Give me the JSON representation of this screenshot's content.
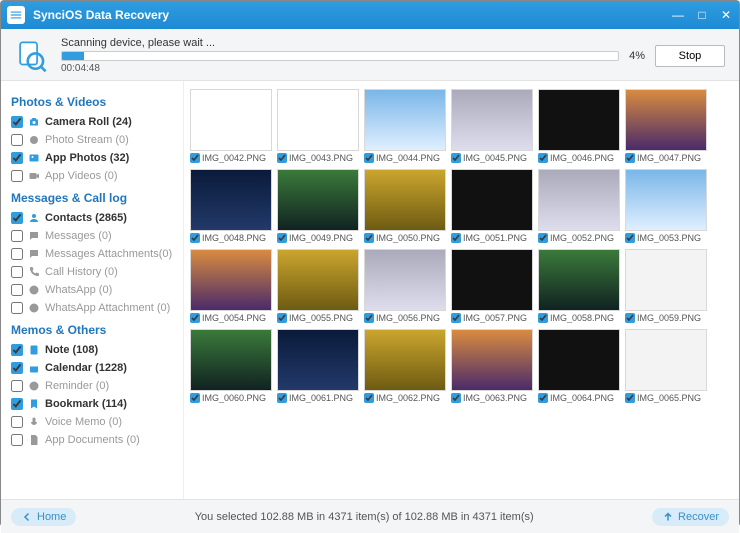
{
  "title": "SynciOS Data Recovery",
  "progress": {
    "label": "Scanning device, please wait ...",
    "elapsed": "00:04:48",
    "percent_text": "4%",
    "percent_value": 4,
    "stop_label": "Stop"
  },
  "sidebar": {
    "groups": [
      {
        "header": "Photos & Videos",
        "items": [
          {
            "checked": true,
            "active": true,
            "icon": "camera-icon",
            "label": "Camera Roll (24)"
          },
          {
            "checked": false,
            "active": false,
            "icon": "stream-icon",
            "label": "Photo Stream (0)"
          },
          {
            "checked": true,
            "active": true,
            "icon": "photo-icon",
            "label": "App Photos (32)"
          },
          {
            "checked": false,
            "active": false,
            "icon": "video-icon",
            "label": "App Videos (0)"
          }
        ]
      },
      {
        "header": "Messages & Call log",
        "items": [
          {
            "checked": true,
            "active": true,
            "icon": "contacts-icon",
            "label": "Contacts (2865)"
          },
          {
            "checked": false,
            "active": false,
            "icon": "message-icon",
            "label": "Messages (0)"
          },
          {
            "checked": false,
            "active": false,
            "icon": "attachment-icon",
            "label": "Messages Attachments(0)"
          },
          {
            "checked": false,
            "active": false,
            "icon": "phone-icon",
            "label": "Call History (0)"
          },
          {
            "checked": false,
            "active": false,
            "icon": "whatsapp-icon",
            "label": "WhatsApp (0)"
          },
          {
            "checked": false,
            "active": false,
            "icon": "whatsapp-attach-icon",
            "label": "WhatsApp Attachment (0)"
          }
        ]
      },
      {
        "header": "Memos & Others",
        "items": [
          {
            "checked": true,
            "active": true,
            "icon": "note-icon",
            "label": "Note (108)"
          },
          {
            "checked": true,
            "active": true,
            "icon": "calendar-icon",
            "label": "Calendar (1228)"
          },
          {
            "checked": false,
            "active": false,
            "icon": "reminder-icon",
            "label": "Reminder (0)"
          },
          {
            "checked": true,
            "active": true,
            "icon": "bookmark-icon",
            "label": "Bookmark (114)"
          },
          {
            "checked": false,
            "active": false,
            "icon": "voice-icon",
            "label": "Voice Memo (0)"
          },
          {
            "checked": false,
            "active": false,
            "icon": "document-icon",
            "label": "App Documents (0)"
          }
        ]
      }
    ]
  },
  "thumbnails": [
    {
      "name": "IMG_0042.PNG",
      "bg": "bg-white"
    },
    {
      "name": "IMG_0043.PNG",
      "bg": "bg-white"
    },
    {
      "name": "IMG_0044.PNG",
      "bg": "bg-blue"
    },
    {
      "name": "IMG_0045.PNG",
      "bg": "bg-grey"
    },
    {
      "name": "IMG_0046.PNG",
      "bg": "bg-dark"
    },
    {
      "name": "IMG_0047.PNG",
      "bg": "bg-sunset"
    },
    {
      "name": "IMG_0048.PNG",
      "bg": "bg-night"
    },
    {
      "name": "IMG_0049.PNG",
      "bg": "bg-green"
    },
    {
      "name": "IMG_0050.PNG",
      "bg": "bg-yel"
    },
    {
      "name": "IMG_0051.PNG",
      "bg": "bg-dark"
    },
    {
      "name": "IMG_0052.PNG",
      "bg": "bg-grey"
    },
    {
      "name": "IMG_0053.PNG",
      "bg": "bg-blue"
    },
    {
      "name": "IMG_0054.PNG",
      "bg": "bg-sunset"
    },
    {
      "name": "IMG_0055.PNG",
      "bg": "bg-yel"
    },
    {
      "name": "IMG_0056.PNG",
      "bg": "bg-grey"
    },
    {
      "name": "IMG_0057.PNG",
      "bg": "bg-dark"
    },
    {
      "name": "IMG_0058.PNG",
      "bg": "bg-green"
    },
    {
      "name": "IMG_0059.PNG",
      "bg": "bg-pale"
    },
    {
      "name": "IMG_0060.PNG",
      "bg": "bg-green"
    },
    {
      "name": "IMG_0061.PNG",
      "bg": "bg-night"
    },
    {
      "name": "IMG_0062.PNG",
      "bg": "bg-yel"
    },
    {
      "name": "IMG_0063.PNG",
      "bg": "bg-sunset"
    },
    {
      "name": "IMG_0064.PNG",
      "bg": "bg-dark"
    },
    {
      "name": "IMG_0065.PNG",
      "bg": "bg-pale"
    }
  ],
  "footer": {
    "home_label": "Home",
    "status_text": "You selected 102.88 MB in 4371 item(s) of 102.88 MB in 4371 item(s)",
    "recover_label": "Recover"
  }
}
